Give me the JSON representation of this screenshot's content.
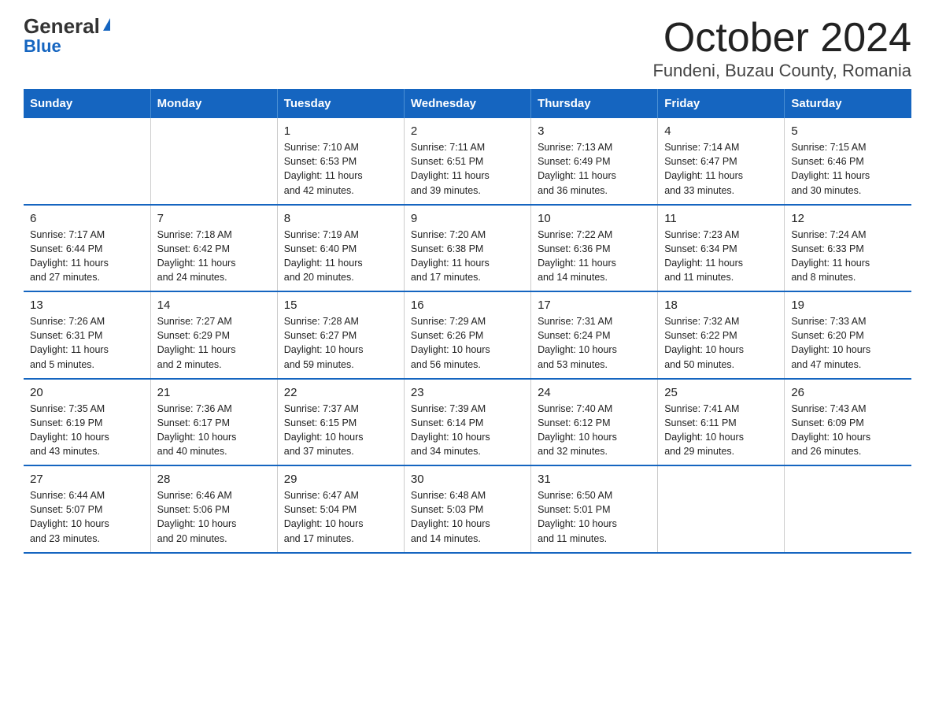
{
  "logo": {
    "general": "General",
    "triangle": "▲",
    "blue": "Blue"
  },
  "title": "October 2024",
  "subtitle": "Fundeni, Buzau County, Romania",
  "days_of_week": [
    "Sunday",
    "Monday",
    "Tuesday",
    "Wednesday",
    "Thursday",
    "Friday",
    "Saturday"
  ],
  "weeks": [
    [
      {
        "day": "",
        "info": ""
      },
      {
        "day": "",
        "info": ""
      },
      {
        "day": "1",
        "info": "Sunrise: 7:10 AM\nSunset: 6:53 PM\nDaylight: 11 hours\nand 42 minutes."
      },
      {
        "day": "2",
        "info": "Sunrise: 7:11 AM\nSunset: 6:51 PM\nDaylight: 11 hours\nand 39 minutes."
      },
      {
        "day": "3",
        "info": "Sunrise: 7:13 AM\nSunset: 6:49 PM\nDaylight: 11 hours\nand 36 minutes."
      },
      {
        "day": "4",
        "info": "Sunrise: 7:14 AM\nSunset: 6:47 PM\nDaylight: 11 hours\nand 33 minutes."
      },
      {
        "day": "5",
        "info": "Sunrise: 7:15 AM\nSunset: 6:46 PM\nDaylight: 11 hours\nand 30 minutes."
      }
    ],
    [
      {
        "day": "6",
        "info": "Sunrise: 7:17 AM\nSunset: 6:44 PM\nDaylight: 11 hours\nand 27 minutes."
      },
      {
        "day": "7",
        "info": "Sunrise: 7:18 AM\nSunset: 6:42 PM\nDaylight: 11 hours\nand 24 minutes."
      },
      {
        "day": "8",
        "info": "Sunrise: 7:19 AM\nSunset: 6:40 PM\nDaylight: 11 hours\nand 20 minutes."
      },
      {
        "day": "9",
        "info": "Sunrise: 7:20 AM\nSunset: 6:38 PM\nDaylight: 11 hours\nand 17 minutes."
      },
      {
        "day": "10",
        "info": "Sunrise: 7:22 AM\nSunset: 6:36 PM\nDaylight: 11 hours\nand 14 minutes."
      },
      {
        "day": "11",
        "info": "Sunrise: 7:23 AM\nSunset: 6:34 PM\nDaylight: 11 hours\nand 11 minutes."
      },
      {
        "day": "12",
        "info": "Sunrise: 7:24 AM\nSunset: 6:33 PM\nDaylight: 11 hours\nand 8 minutes."
      }
    ],
    [
      {
        "day": "13",
        "info": "Sunrise: 7:26 AM\nSunset: 6:31 PM\nDaylight: 11 hours\nand 5 minutes."
      },
      {
        "day": "14",
        "info": "Sunrise: 7:27 AM\nSunset: 6:29 PM\nDaylight: 11 hours\nand 2 minutes."
      },
      {
        "day": "15",
        "info": "Sunrise: 7:28 AM\nSunset: 6:27 PM\nDaylight: 10 hours\nand 59 minutes."
      },
      {
        "day": "16",
        "info": "Sunrise: 7:29 AM\nSunset: 6:26 PM\nDaylight: 10 hours\nand 56 minutes."
      },
      {
        "day": "17",
        "info": "Sunrise: 7:31 AM\nSunset: 6:24 PM\nDaylight: 10 hours\nand 53 minutes."
      },
      {
        "day": "18",
        "info": "Sunrise: 7:32 AM\nSunset: 6:22 PM\nDaylight: 10 hours\nand 50 minutes."
      },
      {
        "day": "19",
        "info": "Sunrise: 7:33 AM\nSunset: 6:20 PM\nDaylight: 10 hours\nand 47 minutes."
      }
    ],
    [
      {
        "day": "20",
        "info": "Sunrise: 7:35 AM\nSunset: 6:19 PM\nDaylight: 10 hours\nand 43 minutes."
      },
      {
        "day": "21",
        "info": "Sunrise: 7:36 AM\nSunset: 6:17 PM\nDaylight: 10 hours\nand 40 minutes."
      },
      {
        "day": "22",
        "info": "Sunrise: 7:37 AM\nSunset: 6:15 PM\nDaylight: 10 hours\nand 37 minutes."
      },
      {
        "day": "23",
        "info": "Sunrise: 7:39 AM\nSunset: 6:14 PM\nDaylight: 10 hours\nand 34 minutes."
      },
      {
        "day": "24",
        "info": "Sunrise: 7:40 AM\nSunset: 6:12 PM\nDaylight: 10 hours\nand 32 minutes."
      },
      {
        "day": "25",
        "info": "Sunrise: 7:41 AM\nSunset: 6:11 PM\nDaylight: 10 hours\nand 29 minutes."
      },
      {
        "day": "26",
        "info": "Sunrise: 7:43 AM\nSunset: 6:09 PM\nDaylight: 10 hours\nand 26 minutes."
      }
    ],
    [
      {
        "day": "27",
        "info": "Sunrise: 6:44 AM\nSunset: 5:07 PM\nDaylight: 10 hours\nand 23 minutes."
      },
      {
        "day": "28",
        "info": "Sunrise: 6:46 AM\nSunset: 5:06 PM\nDaylight: 10 hours\nand 20 minutes."
      },
      {
        "day": "29",
        "info": "Sunrise: 6:47 AM\nSunset: 5:04 PM\nDaylight: 10 hours\nand 17 minutes."
      },
      {
        "day": "30",
        "info": "Sunrise: 6:48 AM\nSunset: 5:03 PM\nDaylight: 10 hours\nand 14 minutes."
      },
      {
        "day": "31",
        "info": "Sunrise: 6:50 AM\nSunset: 5:01 PM\nDaylight: 10 hours\nand 11 minutes."
      },
      {
        "day": "",
        "info": ""
      },
      {
        "day": "",
        "info": ""
      }
    ]
  ]
}
